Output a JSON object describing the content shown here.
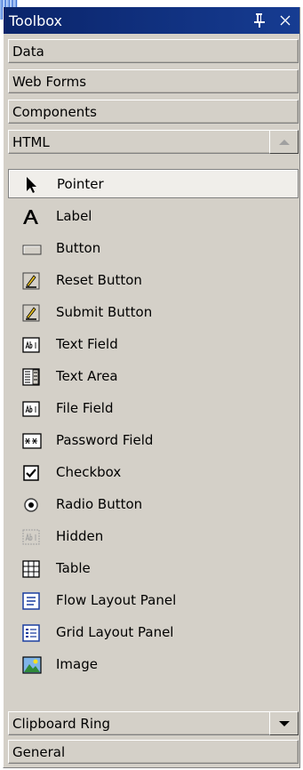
{
  "toolbox": {
    "title": "Toolbox",
    "pin_icon": "pushpin-icon",
    "close_icon": "close-x-icon"
  },
  "tabs_top": [
    {
      "label": "Data"
    },
    {
      "label": "Web Forms"
    },
    {
      "label": "Components"
    },
    {
      "label": "HTML",
      "expanded": true,
      "scroll": "up-arrow"
    }
  ],
  "items": [
    {
      "label": "Pointer",
      "icon": "pointer-arrow-icon",
      "selected": true
    },
    {
      "label": "Label",
      "icon": "label-a-icon"
    },
    {
      "label": "Button",
      "icon": "button-icon"
    },
    {
      "label": "Reset Button",
      "icon": "reset-button-icon"
    },
    {
      "label": "Submit Button",
      "icon": "submit-button-icon"
    },
    {
      "label": "Text Field",
      "icon": "text-field-icon"
    },
    {
      "label": "Text Area",
      "icon": "text-area-icon"
    },
    {
      "label": "File Field",
      "icon": "file-field-icon"
    },
    {
      "label": "Password Field",
      "icon": "password-field-icon"
    },
    {
      "label": "Checkbox",
      "icon": "checkbox-icon"
    },
    {
      "label": "Radio Button",
      "icon": "radio-button-icon"
    },
    {
      "label": "Hidden",
      "icon": "hidden-field-icon"
    },
    {
      "label": "Table",
      "icon": "table-icon"
    },
    {
      "label": "Flow Layout Panel",
      "icon": "flow-layout-panel-icon"
    },
    {
      "label": "Grid Layout Panel",
      "icon": "grid-layout-panel-icon"
    },
    {
      "label": "Image",
      "icon": "image-icon"
    }
  ],
  "tabs_bottom": [
    {
      "label": "Clipboard Ring",
      "scroll": "down-arrow"
    },
    {
      "label": "General"
    }
  ],
  "colors": {
    "titlebar": "#0a246a",
    "face": "#d4d0c8",
    "selected_item": "#f0eeea"
  }
}
